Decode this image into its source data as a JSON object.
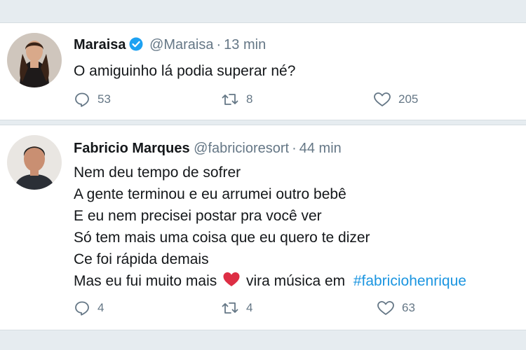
{
  "tweets": [
    {
      "name": "Maraisa",
      "verified": true,
      "handle": "@Maraisa",
      "separator": "·",
      "time": "13 min",
      "lines": [
        "O amiguinho lá podia superar né?"
      ],
      "replies": "53",
      "retweets": "8",
      "likes": "205"
    },
    {
      "name": "Fabricio Marques",
      "verified": false,
      "handle": "@fabricioresort",
      "separator": "·",
      "time": "44 min",
      "lines": [
        "Nem deu tempo de sofrer",
        "A gente terminou e eu arrumei outro bebê",
        "E eu nem precisei postar pra você ver",
        "Só tem mais uma coisa que eu quero te dizer",
        "Ce foi rápida demais"
      ],
      "last_line_before": "Mas eu fui muito mais",
      "last_line_emoji": "red-heart-emoji",
      "last_line_after": "vira música em",
      "hashtag": "#fabriciohenrique",
      "replies": "4",
      "retweets": "4",
      "likes": "63"
    }
  ],
  "colors": {
    "background": "#e6ecf0",
    "text": "#14171a",
    "secondary": "#657786",
    "link": "#1b95e0",
    "verified": "#1da1f2",
    "heart": "#e0245e"
  },
  "icons": [
    "verified-badge-icon",
    "reply-icon",
    "retweet-icon",
    "like-icon",
    "red-heart-emoji"
  ]
}
